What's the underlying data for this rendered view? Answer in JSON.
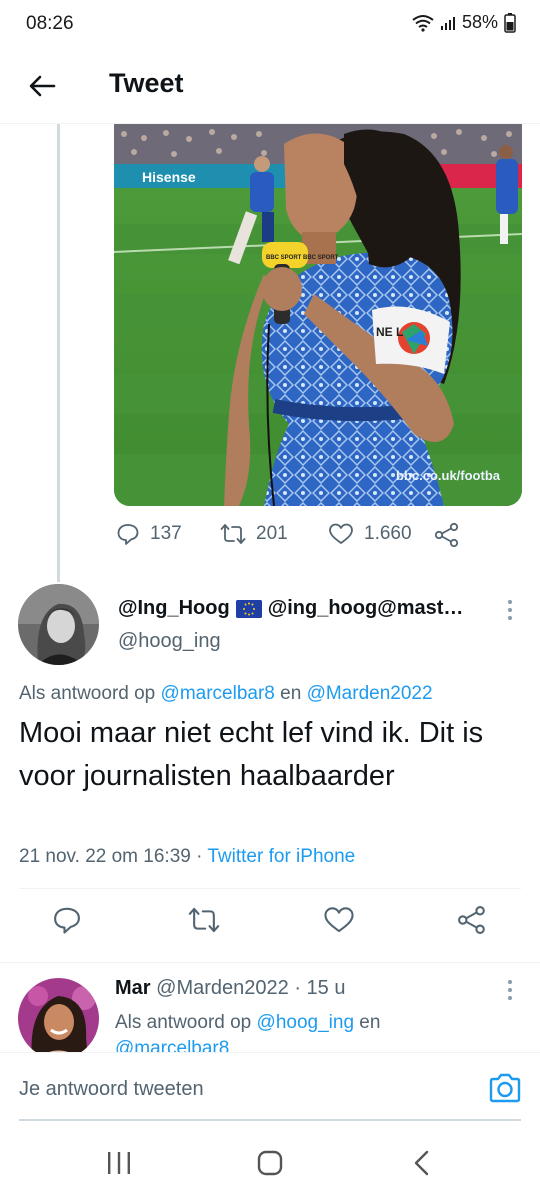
{
  "status_bar": {
    "time": "08:26",
    "battery": "58%",
    "icons": [
      "wifi-icon",
      "signal-icon",
      "battery-icon"
    ]
  },
  "header": {
    "back_icon": "arrow-left-icon",
    "title": "Tweet"
  },
  "media": {
    "overlay_text": "bbc.co.uk/footba",
    "board_text": "Hisense",
    "mic_text": "BBC SPORT BBC SPORT",
    "armband_text": "NE L"
  },
  "top_actions": {
    "replies": "137",
    "retweets": "201",
    "likes": "1.660"
  },
  "reply_tweet": {
    "display_name": "@Ing_Hoog",
    "mastodon": "@ing_hoog@mast…",
    "handle": "@hoog_ing",
    "reply_prefix": "Als antwoord op",
    "reply_user1": "@marcelbar8",
    "reply_and": "en",
    "reply_user2": "@Marden2022",
    "text": "Mooi maar niet echt lef vind ik. Dit is voor journalisten haalbaarder",
    "date": "21 nov. 22 om 16:39",
    "separator": "·",
    "source": "Twitter for iPhone"
  },
  "next_reply": {
    "name": "Mar",
    "handle": "@Marden2022",
    "separator": "·",
    "time": "15 u",
    "reply_prefix": "Als antwoord op",
    "reply_user1": "@hoog_ing",
    "reply_and": "en",
    "reply_user2": "@marcelbar8"
  },
  "compose": {
    "placeholder": "Je antwoord tweeten"
  },
  "colors": {
    "link": "#1d9bf0",
    "secondary_text": "#536471",
    "primary_text": "#0f1419"
  }
}
